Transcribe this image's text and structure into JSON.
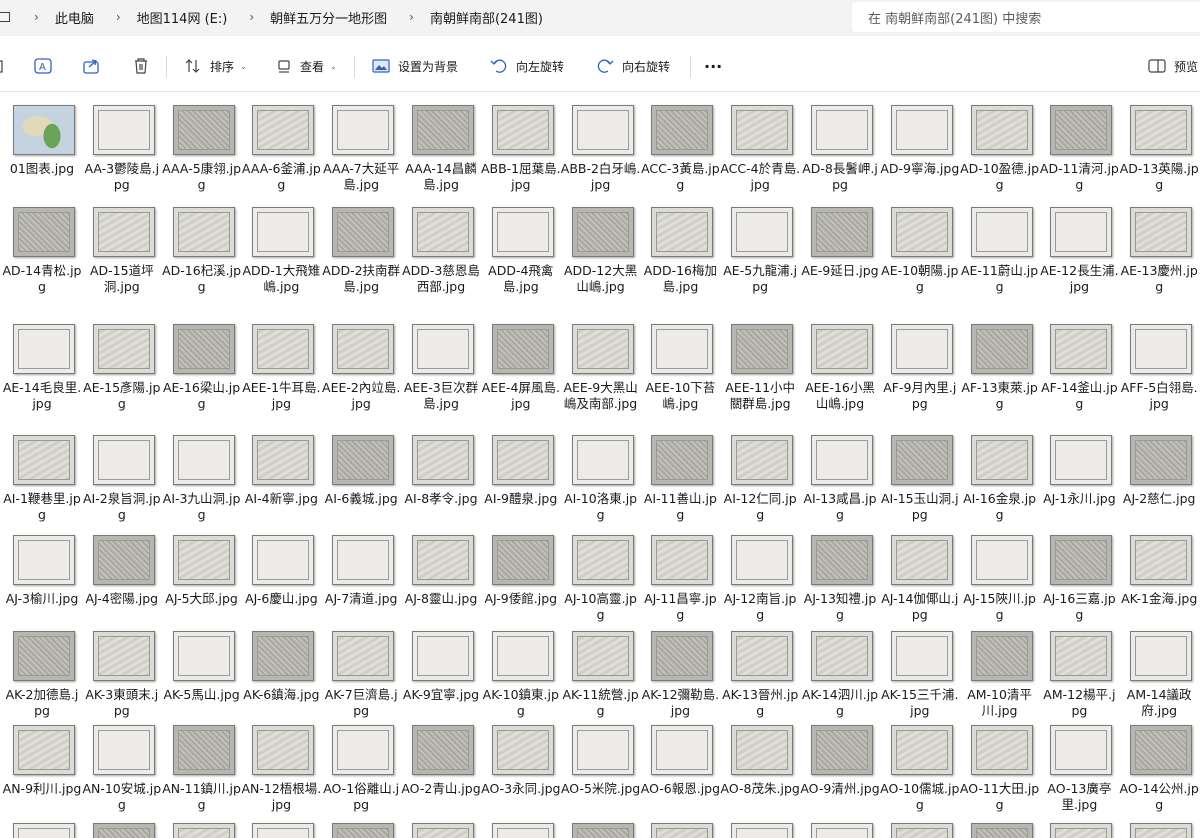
{
  "address": {
    "crumbs": [
      "此电脑",
      "地图114网 (E:)",
      "朝鲜五万分一地形图",
      "南朝鲜南部(241图)"
    ],
    "search_placeholder": "在 南朝鲜南部(241图) 中搜索"
  },
  "toolbar": {
    "sort_label": "排序",
    "view_label": "查看",
    "wallpaper_label": "设置为背景",
    "rotate_left_label": "向左旋转",
    "rotate_right_label": "向右旋转",
    "more_label": "···",
    "preview_label": "预览"
  },
  "files": [
    "01图表.jpg",
    "AA-3鬱陵島.jpg",
    "AAA-5康翎.jpg",
    "AAA-6釜浦.jpg",
    "AAA-7大延平島.jpg",
    "AAA-14昌麟島.jpg",
    "ABB-1屈葉島.jpg",
    "ABB-2白牙嶋.jpg",
    "ACC-3黃島.jpg",
    "ACC-4於青島.jpg",
    "AD-8長鬐岬.jpg",
    "AD-9寧海.jpg",
    "AD-10盈德.jpg",
    "AD-11清河.jpg",
    "AD-13英陽.jpg",
    "AD-14青松.jpg",
    "AD-15道坪洞.jpg",
    "AD-16杞溪.jpg",
    "ADD-1大飛雉嶋.jpg",
    "ADD-2扶南群島.jpg",
    "ADD-3慈恩島西部.jpg",
    "ADD-4飛禽島.jpg",
    "ADD-12大黑山嶋.jpg",
    "ADD-16梅加島.jpg",
    "AE-5九龍浦.jpg",
    "AE-9延日.jpg",
    "AE-10朝陽.jpg",
    "AE-11蔚山.jpg",
    "AE-12長生浦.jpg",
    "AE-13慶州.jpg",
    "AE-14毛良里.jpg",
    "AE-15彥陽.jpg",
    "AE-16梁山.jpg",
    "AEE-1牛耳島.jpg",
    "AEE-2內竝島.jpg",
    "AEE-3巨次群島.jpg",
    "AEE-4屏風島.jpg",
    "AEE-9大黑山嶋及南部.jpg",
    "AEE-10下苔嶋.jpg",
    "AEE-11小中關群島.jpg",
    "AEE-16小黑山嶋.jpg",
    "AF-9月內里.jpg",
    "AF-13東萊.jpg",
    "AF-14釜山.jpg",
    "AFF-5白翎島.jpg",
    "AI-1鞭巷里.jpg",
    "AI-2泉旨洞.jpg",
    "AI-3九山洞.jpg",
    "AI-4新寧.jpg",
    "AI-6義城.jpg",
    "AI-8孝令.jpg",
    "AI-9醴泉.jpg",
    "AI-10洛東.jpg",
    "AI-11善山.jpg",
    "AI-12仁同.jpg",
    "AI-13咸昌.jpg",
    "AI-15玉山洞.jpg",
    "AI-16金泉.jpg",
    "AJ-1永川.jpg",
    "AJ-2慈仁.jpg",
    "AJ-3榆川.jpg",
    "AJ-4密陽.jpg",
    "AJ-5大邱.jpg",
    "AJ-6慶山.jpg",
    "AJ-7清道.jpg",
    "AJ-8靈山.jpg",
    "AJ-9倭館.jpg",
    "AJ-10高靈.jpg",
    "AJ-11昌寧.jpg",
    "AJ-12南旨.jpg",
    "AJ-13知禮.jpg",
    "AJ-14伽倻山.jpg",
    "AJ-15陜川.jpg",
    "AJ-16三嘉.jpg",
    "AK-1金海.jpg",
    "AK-2加德島.jpg",
    "AK-3東頭末.jpg",
    "AK-5馬山.jpg",
    "AK-6鎮海.jpg",
    "AK-7巨濟島.jpg",
    "AK-9宜寧.jpg",
    "AK-10鎮東.jpg",
    "AK-11統營.jpg",
    "AK-12彌勒島.jpg",
    "AK-13晉州.jpg",
    "AK-14泗川.jpg",
    "AK-15三千浦.jpg",
    "AM-10清平川.jpg",
    "AM-12楊平.jpg",
    "AM-14議政府.jpg",
    "AN-9利川.jpg",
    "AN-10安城.jpg",
    "AN-11鎮川.jpg",
    "AN-12梧根場.jpg",
    "AO-1俗離山.jpg",
    "AO-2青山.jpg",
    "AO-3永同.jpg",
    "AO-5米院.jpg",
    "AO-6報恩.jpg",
    "AO-8茂朱.jpg",
    "AO-9清州.jpg",
    "AO-10儒城.jpg",
    "AO-11大田.jpg",
    "AO-13廣亭里.jpg",
    "AO-14公州.jpg",
    "",
    "",
    "",
    "",
    "",
    "",
    "",
    "",
    "",
    "",
    "",
    "",
    "",
    "",
    ""
  ]
}
